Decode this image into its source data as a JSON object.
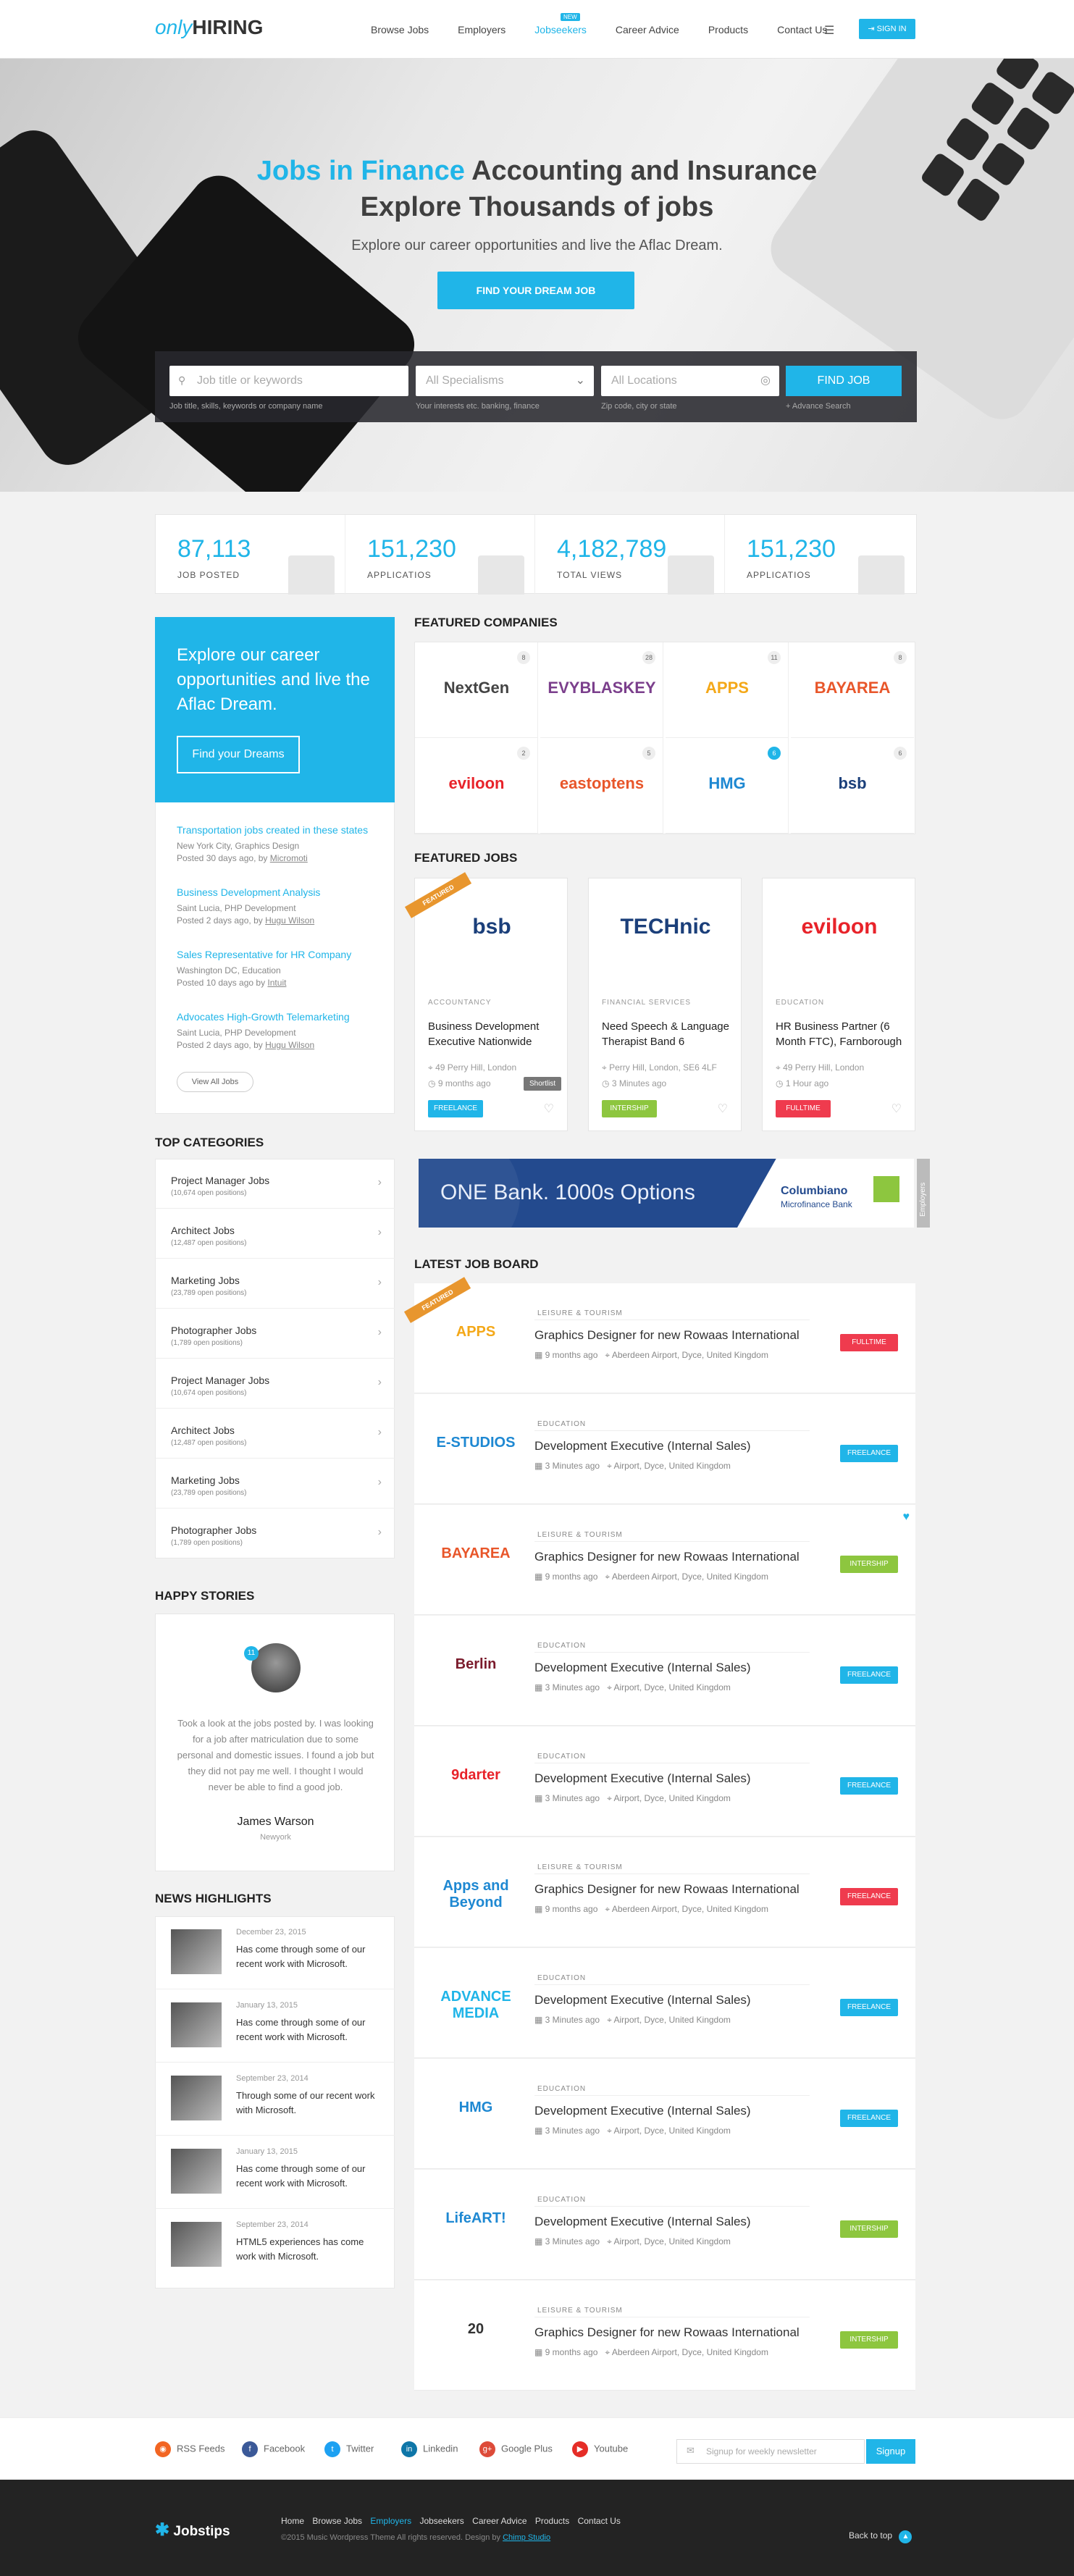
{
  "header": {
    "logo_only": "only",
    "logo_hiring": "HIRING",
    "nav": [
      "Browse Jobs",
      "Employers",
      "Jobseekers",
      "Career Advice",
      "Products",
      "Contact Us"
    ],
    "new_badge": "NEW",
    "signin": "SIGN IN",
    "accent": "#20b5e8"
  },
  "hero": {
    "title_blue": "Jobs in Finance",
    "title_rest": " Accounting and Insurance",
    "title_line2": "Explore Thousands of jobs",
    "subtitle": "Explore our career opportunities and live the Aflac Dream.",
    "cta": "FIND YOUR DREAM JOB"
  },
  "search": {
    "keyword_placeholder": "Job title or keywords",
    "keyword_hint": "Job title, skills, keywords or company name",
    "specialism": "All Specialisms",
    "specialism_hint": "Your interests etc. banking, finance",
    "location": "All Locations",
    "location_hint": "Zip code, city or state",
    "button": "FIND JOB",
    "advanced": "+ Advance Search"
  },
  "stats": [
    {
      "n": "87,113",
      "l": "JOB POSTED"
    },
    {
      "n": "151,230",
      "l": "APPLICATIOS"
    },
    {
      "n": "4,182,789",
      "l": "TOTAL VIEWS"
    },
    {
      "n": "151,230",
      "l": "APPLICATIOS"
    }
  ],
  "promo": {
    "text": "Explore our career opportunities and live the Aflac Dream.",
    "button": "Find your Dreams"
  },
  "recent_jobs": [
    {
      "t": "Transportation jobs created in these states",
      "m1": "New York City, Graphics Design",
      "m2": "Posted 30 days ago, by ",
      "by": "Micromoti"
    },
    {
      "t": "Business Development Analysis",
      "m1": "Saint Lucia, PHP Development",
      "m2": "Posted 2 days ago, by ",
      "by": "Hugu Wilson"
    },
    {
      "t": "Sales Representative for HR Company",
      "m1": "Washington DC, Education",
      "m2": "Posted 10 days ago by ",
      "by": "Intuit"
    },
    {
      "t": "Advocates High-Growth Telemarketing",
      "m1": "Saint Lucia, PHP Development",
      "m2": "Posted 2 days ago, by ",
      "by": "Hugu Wilson"
    }
  ],
  "view_all": "View All Jobs",
  "sections": {
    "categories": "TOP CATEGORIES",
    "stories": "HAPPY STORIES",
    "news": "NEWS HIGHLIGHTS",
    "companies": "FEATURED COMPANIES",
    "jobs": "FEATURED JOBS",
    "board": "LATEST JOB BOARD"
  },
  "categories": [
    {
      "t": "Project Manager Jobs",
      "m": "(10,674 open positions)"
    },
    {
      "t": "Architect Jobs",
      "m": "(12,487 open positions)"
    },
    {
      "t": "Marketing Jobs",
      "m": "(23,789 open positions)"
    },
    {
      "t": "Photographer Jobs",
      "m": "(1,789 open positions)"
    },
    {
      "t": "Project Manager Jobs",
      "m": "(10,674 open positions)"
    },
    {
      "t": "Architect Jobs",
      "m": "(12,487 open positions)"
    },
    {
      "t": "Marketing Jobs",
      "m": "(23,789 open positions)"
    },
    {
      "t": "Photographer Jobs",
      "m": "(1,789 open positions)"
    }
  ],
  "story": {
    "count": "11",
    "quote": "Took a look at the jobs posted by. I was looking for a job after matriculation due to some personal and domestic issues. I found a job but they did not pay me well. I thought I would never be able to find a good job.",
    "name": "James Warson",
    "city": "Newyork"
  },
  "news": [
    {
      "d": "December 23, 2015",
      "t": "Has come through some of our recent work with Microsoft."
    },
    {
      "d": "January 13, 2015",
      "t": "Has come through some of our recent work with Microsoft."
    },
    {
      "d": "September 23, 2014",
      "t": "Through some of our recent work with Microsoft."
    },
    {
      "d": "January 13, 2015",
      "t": "Has come through some of our recent work with Microsoft."
    },
    {
      "d": "September 23, 2014",
      "t": "HTML5 experiences has come work with Microsoft."
    }
  ],
  "companies": [
    {
      "name": "NextGen",
      "count": "8",
      "color": "#444"
    },
    {
      "name": "EVYBLASKEY",
      "count": "28",
      "color": "#7b3f8c"
    },
    {
      "name": "APPS",
      "count": "11",
      "color": "#f4a818"
    },
    {
      "name": "BAYAREA",
      "count": "8",
      "color": "#e8562a"
    },
    {
      "name": "eviloon",
      "count": "2",
      "color": "#e8232a"
    },
    {
      "name": "eastoptens",
      "count": "5",
      "color": "#e8562a"
    },
    {
      "name": "HMG",
      "count": "6",
      "color": "#1e88d2"
    },
    {
      "name": "bsb",
      "count": "6",
      "color": "#1b3f7a"
    }
  ],
  "featured_jobs": [
    {
      "logo": "bsb",
      "logo_color": "#1b3f7a",
      "sec": "ACCOUNTANCY",
      "t": "Business Development Executive Nationwide",
      "loc": "49 Perry Hill, London",
      "time": "9 months ago",
      "tag": "FREELANCE",
      "tag_color": "#20b5e8",
      "ribbon": "FEATURED"
    },
    {
      "logo": "TECHnic",
      "logo_color": "#1b3f7a",
      "sec": "FINANCIAL SERVICES",
      "t": "Need Speech & Language Therapist Band 6",
      "loc": "Perry Hill, London, SE6 4LF",
      "time": "3 Minutes ago",
      "tag": "INTERSHIP",
      "tag_color": "#8dc63f"
    },
    {
      "logo": "eviloon",
      "logo_color": "#e8232a",
      "sec": "EDUCATION",
      "t": "HR Business Partner (6 Month FTC), Farnborough",
      "loc": "49 Perry Hill, London",
      "time": "1 Hour ago",
      "tag": "FULLTIME",
      "tag_color": "#ef3b4e"
    }
  ],
  "shortlist": "Shortlist",
  "banner": {
    "text": "ONE Bank. 1000s Options",
    "brand": "Columbiano",
    "brand_sub": "Microfinance Bank",
    "side": "Employers"
  },
  "board": [
    {
      "logo": "APPS",
      "color": "#f4a818",
      "sec": "LEISURE & TOURISM",
      "t": "Graphics Designer for new Rowaas International",
      "time": "9 months ago",
      "loc": "Aberdeen Airport, Dyce, United Kingdom",
      "tag": "FULLTIME",
      "tag_color": "#ef3b4e",
      "ribbon": "FEATURED"
    },
    {
      "logo": "E-STUDIOS",
      "color": "#1e88d2",
      "sec": "EDUCATION",
      "t": "Development Executive (Internal Sales)",
      "time": "3 Minutes ago",
      "loc": "Airport, Dyce, United Kingdom",
      "tag": "FREELANCE",
      "tag_color": "#20b5e8"
    },
    {
      "logo": "BAYAREA",
      "color": "#e8562a",
      "sec": "LEISURE & TOURISM",
      "t": "Graphics Designer for new Rowaas International",
      "time": "9 months ago",
      "loc": "Aberdeen Airport, Dyce, United Kingdom",
      "tag": "INTERSHIP",
      "tag_color": "#8dc63f",
      "fav": "♥"
    },
    {
      "logo": "Berlin",
      "color": "#7b1b2c",
      "sec": "EDUCATION",
      "t": "Development Executive (Internal Sales)",
      "time": "3 Minutes ago",
      "loc": "Airport, Dyce, United Kingdom",
      "tag": "FREELANCE",
      "tag_color": "#20b5e8"
    },
    {
      "logo": "9darter",
      "color": "#e8232a",
      "sec": "EDUCATION",
      "t": "Development Executive (Internal Sales)",
      "time": "3 Minutes ago",
      "loc": "Airport, Dyce, United Kingdom",
      "tag": "FREELANCE",
      "tag_color": "#20b5e8"
    },
    {
      "logo": "Apps and Beyond",
      "color": "#1e88d2",
      "sec": "LEISURE & TOURISM",
      "t": "Graphics Designer for new Rowaas International",
      "time": "9 months ago",
      "loc": "Aberdeen Airport, Dyce, United Kingdom",
      "tag": "FREELANCE",
      "tag_color": "#ef3b4e"
    },
    {
      "logo": "ADVANCE MEDIA",
      "color": "#20b5e8",
      "sec": "EDUCATION",
      "t": "Development Executive (Internal Sales)",
      "time": "3 Minutes ago",
      "loc": "Airport, Dyce, United Kingdom",
      "tag": "FREELANCE",
      "tag_color": "#20b5e8"
    },
    {
      "logo": "HMG",
      "color": "#1e88d2",
      "sec": "EDUCATION",
      "t": "Development Executive (Internal Sales)",
      "time": "3 Minutes ago",
      "loc": "Airport, Dyce, United Kingdom",
      "tag": "FREELANCE",
      "tag_color": "#20b5e8"
    },
    {
      "logo": "LifeART!",
      "color": "#1e88d2",
      "sec": "EDUCATION",
      "t": "Development Executive (Internal Sales)",
      "time": "3 Minutes ago",
      "loc": "Airport, Dyce, United Kingdom",
      "tag": "INTERSHIP",
      "tag_color": "#8dc63f"
    },
    {
      "logo": "20",
      "color": "#333",
      "sec": "LEISURE & TOURISM",
      "t": "Graphics Designer for new Rowaas International",
      "time": "9 months ago",
      "loc": "Aberdeen Airport, Dyce, United Kingdom",
      "tag": "INTERSHIP",
      "tag_color": "#8dc63f"
    }
  ],
  "social": [
    {
      "n": "RSS Feeds",
      "c": "#f26522"
    },
    {
      "n": "Facebook",
      "c": "#3b5998"
    },
    {
      "n": "Twitter",
      "c": "#1da1f2"
    },
    {
      "n": "Linkedin",
      "c": "#0e76a8"
    },
    {
      "n": "Google Plus",
      "c": "#dd4b39"
    },
    {
      "n": "Youtube",
      "c": "#e52d27"
    }
  ],
  "newsletter": {
    "placeholder": "Signup for weekly newsletter",
    "button": "Signup"
  },
  "footer": {
    "logo": "Jobstips",
    "links": [
      "Home",
      "Browse Jobs",
      "Employers",
      "Jobseekers",
      "Career Advice",
      "Products",
      "Contact Us"
    ],
    "copyright": "©2015 Music Wordpress Theme All rights reserved. Design by ",
    "designer": "Chimp Studio",
    "back": "Back to top"
  }
}
